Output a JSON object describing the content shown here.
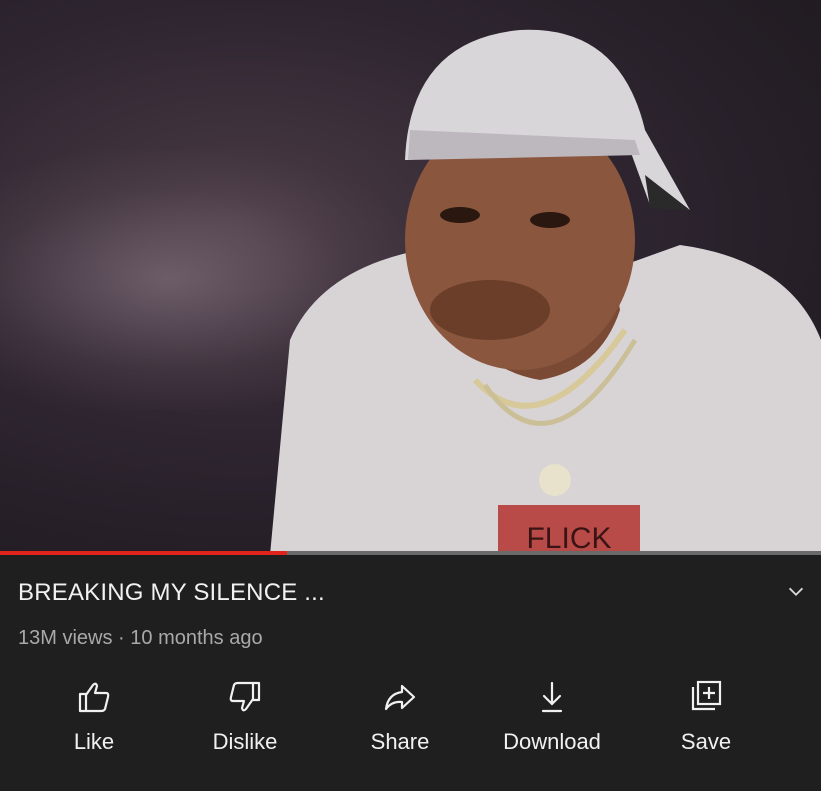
{
  "video": {
    "title": "BREAKING MY SILENCE ...",
    "views": "13M views",
    "separator": "·",
    "age": "10 months ago",
    "progress_fraction": 0.35,
    "progress_color": "#e0241b",
    "shirt_print": "FLICK"
  },
  "actions": [
    {
      "label": "Like",
      "icon": "thumbs-up-icon"
    },
    {
      "label": "Dislike",
      "icon": "thumbs-down-icon"
    },
    {
      "label": "Share",
      "icon": "share-arrow-icon"
    },
    {
      "label": "Download",
      "icon": "download-icon"
    },
    {
      "label": "Save",
      "icon": "add-to-playlist-icon"
    }
  ],
  "icons": {
    "expand": "chevron-down-icon"
  }
}
